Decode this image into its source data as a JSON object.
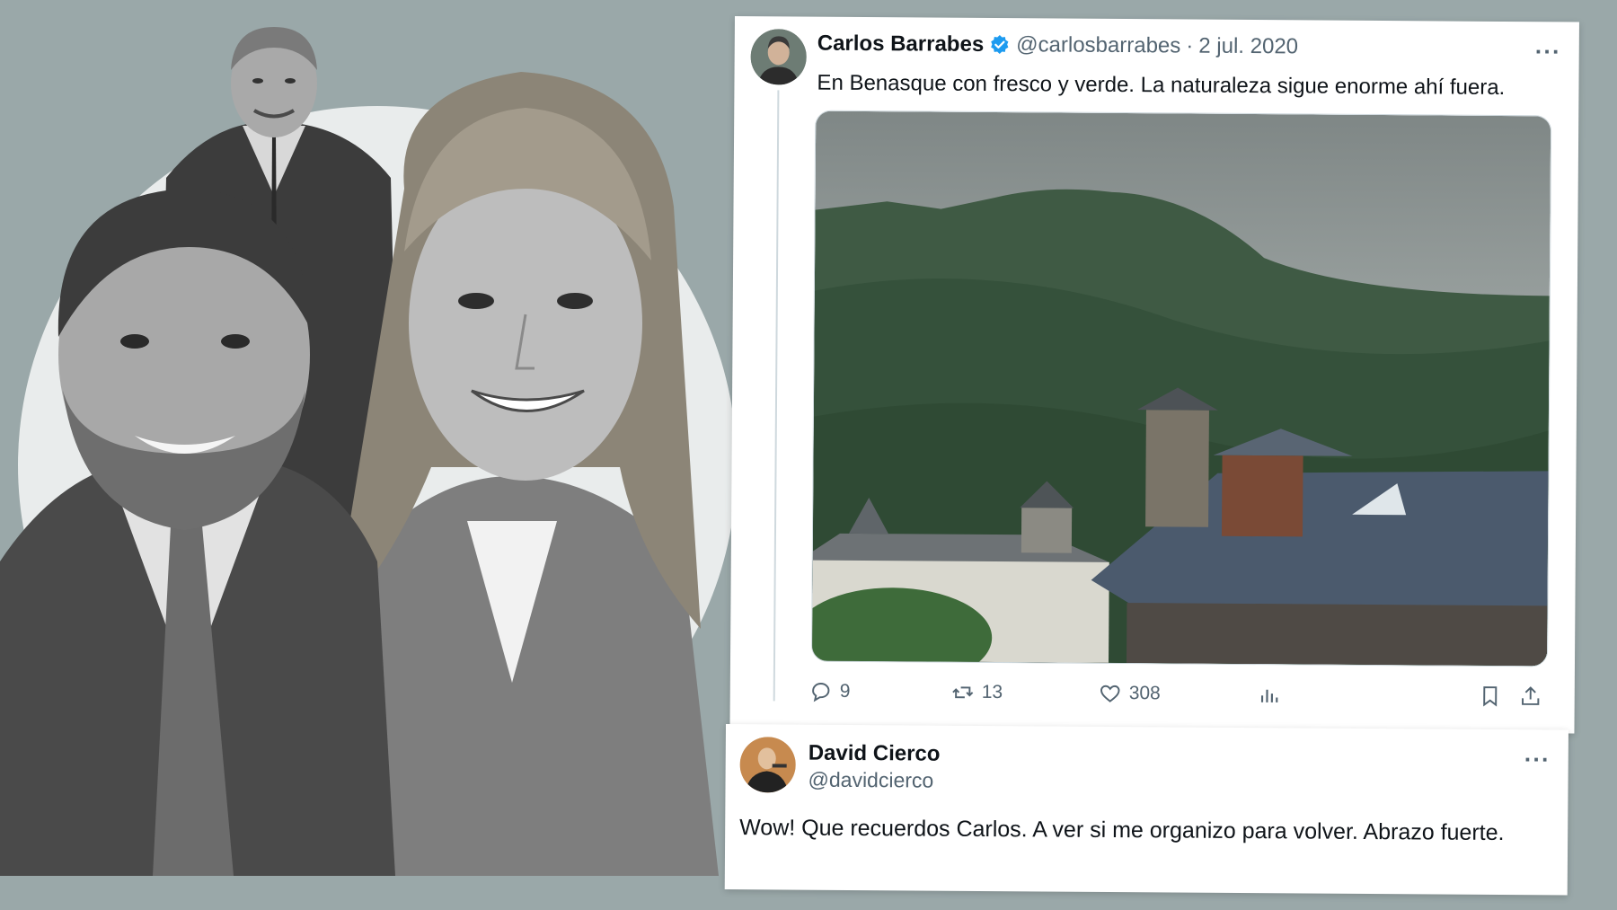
{
  "tweet": {
    "author_name": "Carlos Barrabes",
    "handle": "@carlosbarrabes",
    "separator": "·",
    "date": "2 jul. 2020",
    "text": "En Benasque con fresco y verde. La naturaleza sigue enorme ahí fuera.",
    "more": "···",
    "verified": true,
    "media_description_icon": "photo",
    "stats": {
      "replies": "9",
      "retweets": "13",
      "likes": "308"
    }
  },
  "reply": {
    "author_name": "David Cierco",
    "handle": "@davidcierco",
    "more": "···",
    "text": "Wow! Que recuerdos Carlos. A ver si me organizo para volver. Abrazo fuerte."
  },
  "colors": {
    "background": "#9aa8a9",
    "verified": "#1d9bf0",
    "secondary_text": "#536471"
  },
  "icons": [
    "reply-icon",
    "retweet-icon",
    "like-icon",
    "views-icon",
    "bookmark-icon",
    "share-icon",
    "verified-badge-icon",
    "more-icon"
  ]
}
